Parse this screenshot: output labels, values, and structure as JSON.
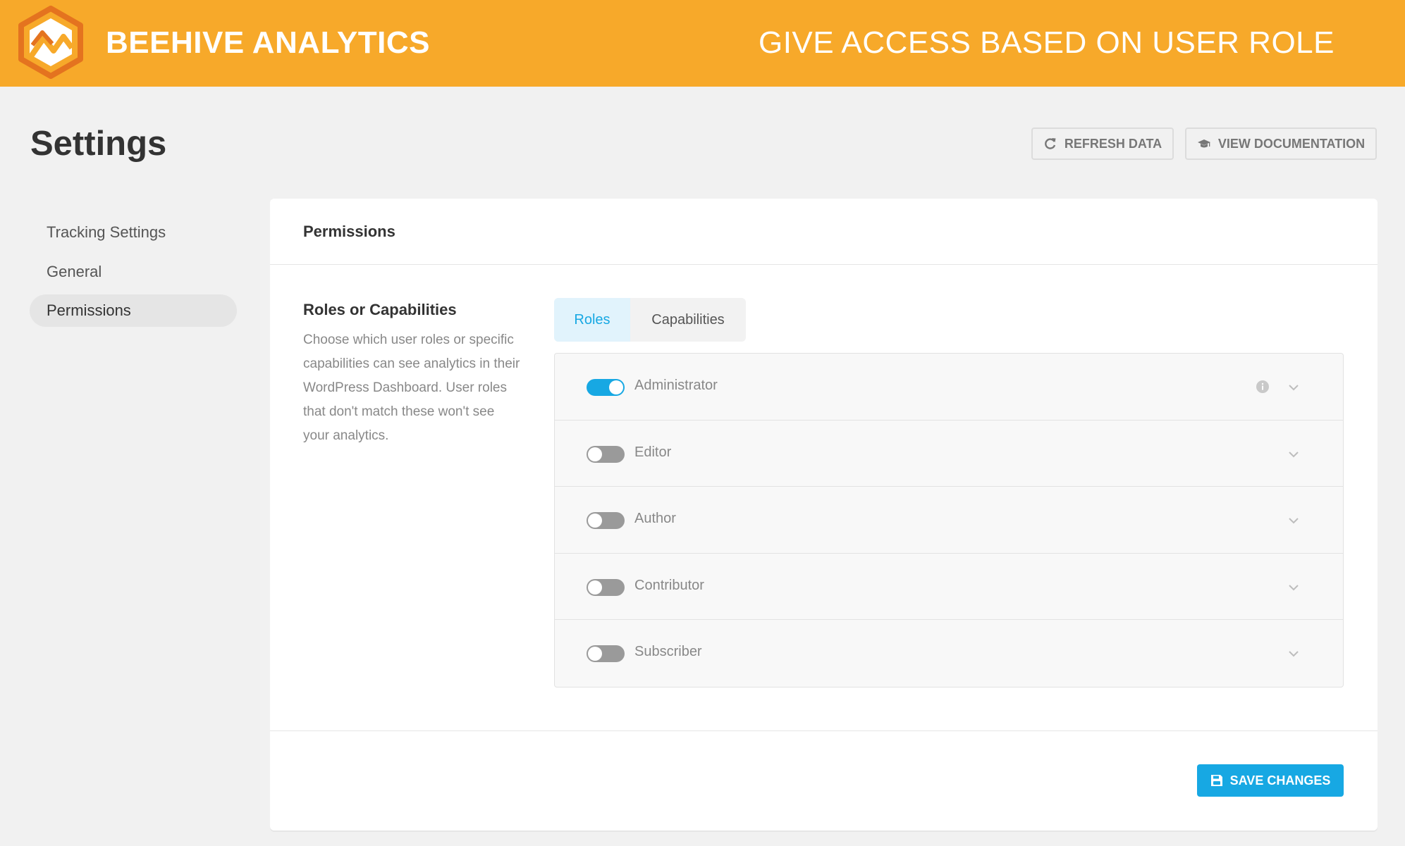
{
  "banner": {
    "brand": "BEEHIVE ANALYTICS",
    "tagline": "GIVE ACCESS BASED ON USER ROLE",
    "color": "#f7a92a"
  },
  "header": {
    "title": "Settings",
    "refresh_label": "REFRESH DATA",
    "docs_label": "VIEW DOCUMENTATION"
  },
  "sidebar": {
    "items": [
      {
        "label": "Tracking Settings",
        "active": false
      },
      {
        "label": "General",
        "active": false
      },
      {
        "label": "Permissions",
        "active": true
      }
    ]
  },
  "card": {
    "title": "Permissions",
    "section_title": "Roles or Capabilities",
    "section_desc": "Choose which user roles or specific capabilities can see analytics in their WordPress Dashboard. User roles that don't match these won't see your analytics.",
    "tabs": [
      {
        "label": "Roles",
        "active": true
      },
      {
        "label": "Capabilities",
        "active": false
      }
    ],
    "roles": [
      {
        "label": "Administrator",
        "enabled": true,
        "has_info": true
      },
      {
        "label": "Editor",
        "enabled": false,
        "has_info": false
      },
      {
        "label": "Author",
        "enabled": false,
        "has_info": false
      },
      {
        "label": "Contributor",
        "enabled": false,
        "has_info": false
      },
      {
        "label": "Subscriber",
        "enabled": false,
        "has_info": false
      }
    ],
    "save_label": "SAVE CHANGES"
  },
  "colors": {
    "accent": "#17a8e3",
    "brand": "#f7a92a"
  },
  "icons": {
    "refresh": "refresh-icon",
    "docs": "graduation-cap-icon",
    "info": "info-icon",
    "chevron": "chevron-down-icon",
    "save": "floppy-disk-icon"
  }
}
